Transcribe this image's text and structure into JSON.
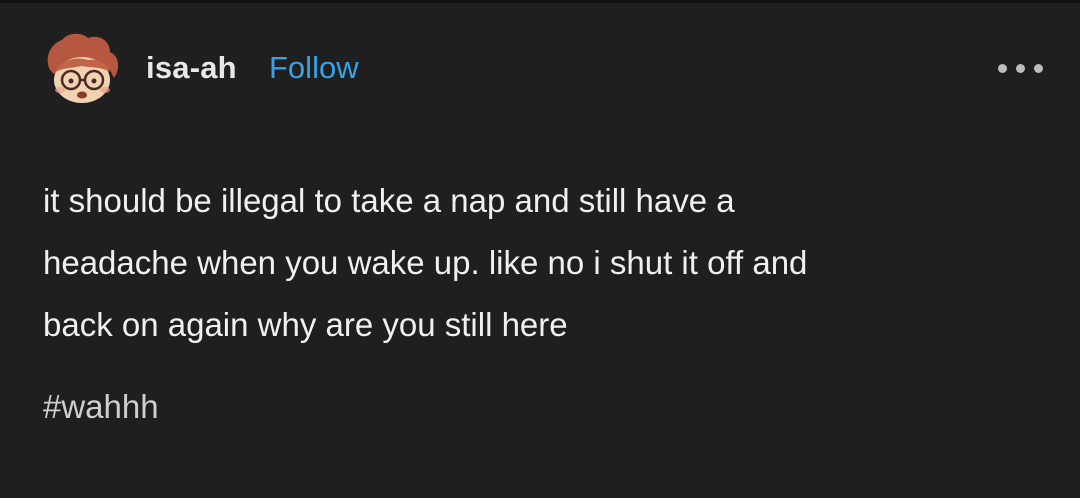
{
  "post": {
    "username": "isa-ah",
    "follow_label": "Follow",
    "more_icon": "more-horizontal-icon",
    "body_lines": [
      "it should be illegal to take a nap and still have a",
      "headache when you wake up. like no i shut it off and",
      "back on again why are you still here"
    ],
    "tags": [
      "#wahhh"
    ]
  },
  "colors": {
    "background": "#1f1f1f",
    "text": "#f0f0f0",
    "follow": "#3aa0e4",
    "tag": "#cfcfcf"
  }
}
